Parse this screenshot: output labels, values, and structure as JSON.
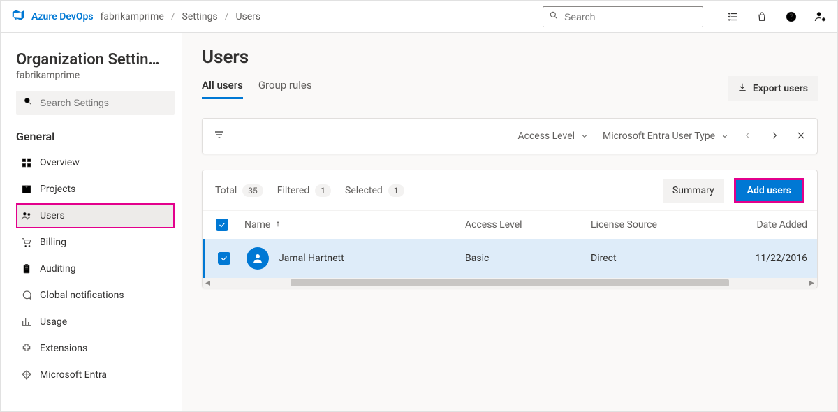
{
  "header": {
    "product": "Azure DevOps",
    "org": "fabrikamprime",
    "breadcrumbs": [
      "Settings",
      "Users"
    ],
    "search_placeholder": "Search"
  },
  "sidebar": {
    "title": "Organization Settin…",
    "subtitle": "fabrikamprime",
    "search_placeholder": "Search Settings",
    "section": "General",
    "items": [
      {
        "label": "Overview",
        "icon": "grid-icon"
      },
      {
        "label": "Projects",
        "icon": "project-icon"
      },
      {
        "label": "Users",
        "icon": "users-icon",
        "selected": true,
        "highlighted": true
      },
      {
        "label": "Billing",
        "icon": "cart-icon"
      },
      {
        "label": "Auditing",
        "icon": "clipboard-icon"
      },
      {
        "label": "Global notifications",
        "icon": "chat-icon"
      },
      {
        "label": "Usage",
        "icon": "usage-icon"
      },
      {
        "label": "Extensions",
        "icon": "extension-icon"
      },
      {
        "label": "Microsoft Entra",
        "icon": "entra-icon"
      }
    ]
  },
  "page": {
    "title": "Users",
    "tabs": [
      {
        "label": "All users",
        "active": true
      },
      {
        "label": "Group rules",
        "active": false
      }
    ],
    "export_label": "Export users"
  },
  "filters": {
    "access_level": "Access Level",
    "entra_type": "Microsoft Entra User Type"
  },
  "toolbar": {
    "total_label": "Total",
    "total_count": "35",
    "filtered_label": "Filtered",
    "filtered_count": "1",
    "selected_label": "Selected",
    "selected_count": "1",
    "summary_label": "Summary",
    "add_users_label": "Add users"
  },
  "table": {
    "columns": {
      "name": "Name",
      "access_level": "Access Level",
      "license_source": "License Source",
      "date_added": "Date Added"
    },
    "rows": [
      {
        "name": "Jamal Hartnett",
        "access_level": "Basic",
        "license_source": "Direct",
        "date_added": "11/22/2016",
        "selected": true
      }
    ]
  }
}
